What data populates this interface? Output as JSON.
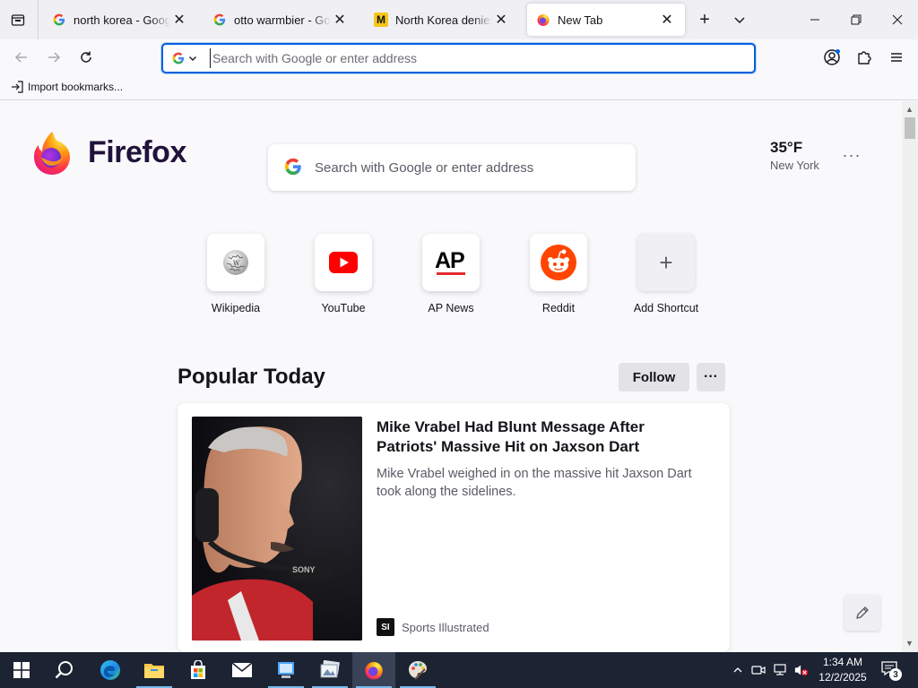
{
  "browser": {
    "tabs": [
      {
        "title": "north korea - Google Search",
        "favicon": "google-g-icon",
        "active": false
      },
      {
        "title": "otto warmbier - Google Search",
        "favicon": "google-g-icon",
        "active": false
      },
      {
        "title": "North Korea denies cruel treatment",
        "favicon": "m-letter-icon",
        "active": false
      },
      {
        "title": "New Tab",
        "favicon": "firefox-icon",
        "active": true
      }
    ],
    "urlbar": {
      "placeholder": "Search with Google or enter address",
      "value": ""
    },
    "bookmarks": {
      "import_label": "Import bookmarks..."
    }
  },
  "newtab": {
    "brand": "Firefox",
    "search_placeholder": "Search with Google or enter address",
    "weather": {
      "temp": "35°F",
      "city": "New York"
    },
    "shortcuts": [
      {
        "label": "Wikipedia",
        "icon": "wikipedia-globe-icon"
      },
      {
        "label": "YouTube",
        "icon": "youtube-icon"
      },
      {
        "label": "AP News",
        "icon": "ap-news-icon"
      },
      {
        "label": "Reddit",
        "icon": "reddit-icon"
      },
      {
        "label": "Add Shortcut",
        "icon": "plus-icon"
      }
    ],
    "section": {
      "title": "Popular Today",
      "follow_label": "Follow"
    },
    "story": {
      "headline": "Mike Vrabel Had Blunt Message After Patriots' Massive Hit on Jaxson Dart",
      "excerpt": "Mike Vrabel weighed in on the massive hit Jaxson Dart took along the sidelines.",
      "source": "Sports Illustrated",
      "source_logo": "SI"
    }
  },
  "taskbar": {
    "time": "1:34 AM",
    "date": "12/2/2025",
    "notification_count": "3"
  },
  "colors": {
    "accent": "#0061e0",
    "taskbar": "#1c2433",
    "wordmark": "#20123a"
  }
}
